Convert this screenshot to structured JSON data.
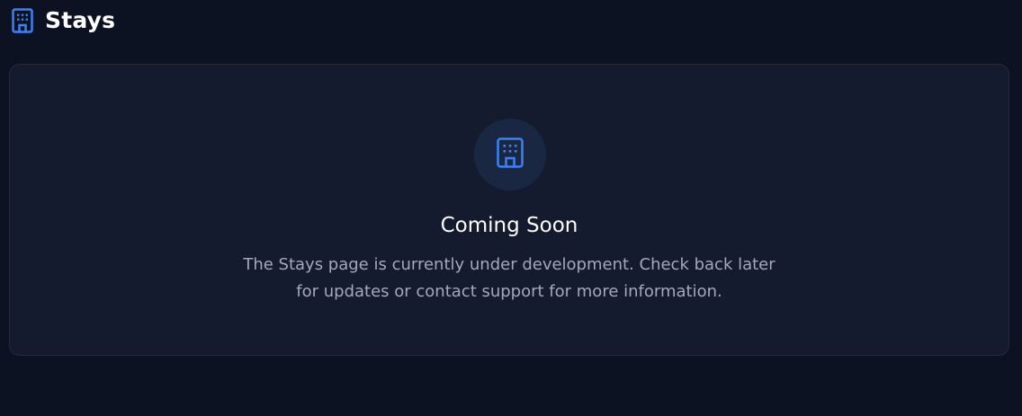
{
  "header": {
    "icon": "building-icon",
    "title": "Stays"
  },
  "placeholder": {
    "icon": "building-icon",
    "title": "Coming Soon",
    "message": "The Stays page is currently under development. Check back later for updates or contact support for more information."
  },
  "colors": {
    "background": "#0d1222",
    "card": "#151b2e",
    "accent": "#3b82f6",
    "muted_text": "#a3a9b8"
  }
}
